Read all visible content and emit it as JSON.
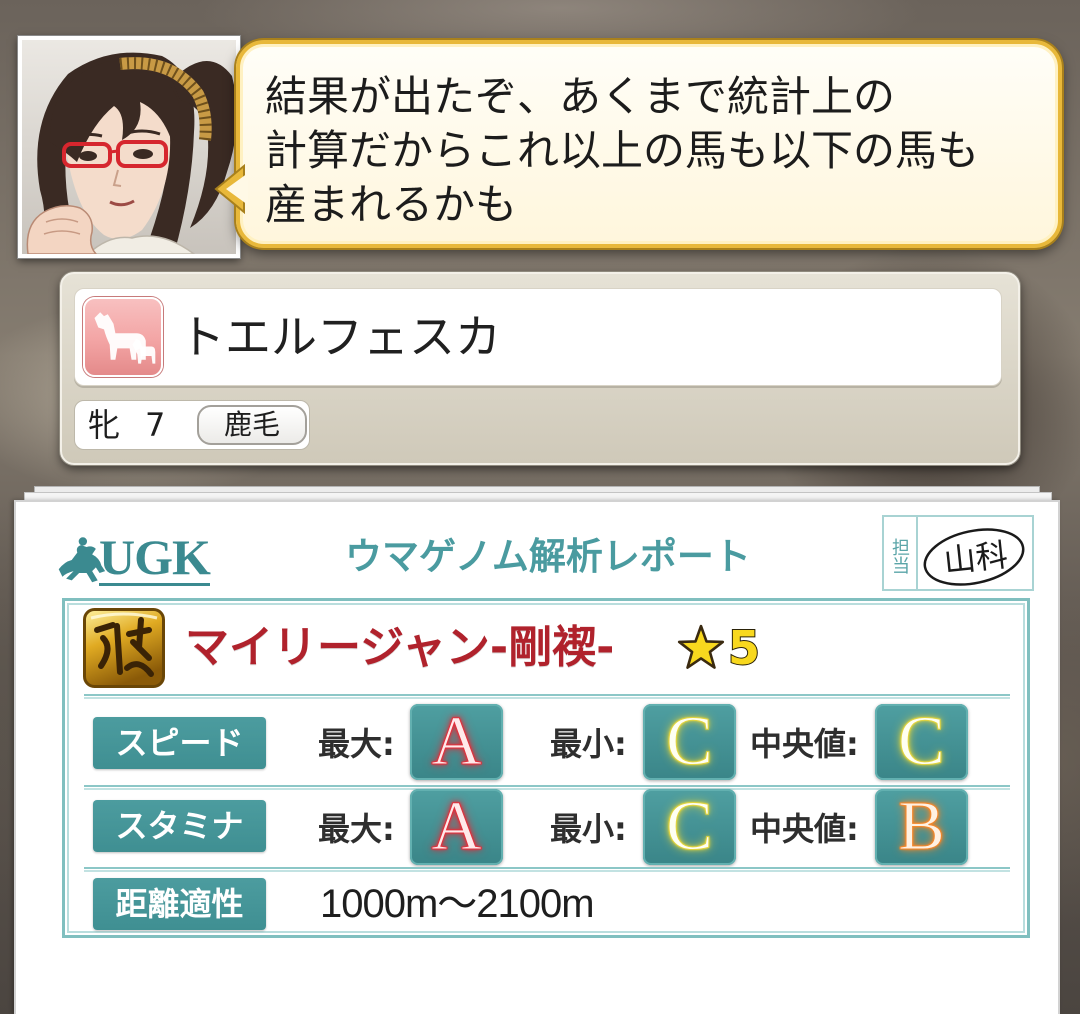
{
  "dialog": {
    "lines": [
      "結果が出たぞ、あくまで統計上の",
      "計算だからこれ以上の馬も以下の馬も",
      "産まれるかも"
    ]
  },
  "horse": {
    "icon": "mare-horse-icon",
    "name": "トエルフェスカ",
    "sex": "牝",
    "age": "7",
    "coat": "鹿毛"
  },
  "report": {
    "logo_icon": "ugk-horse-logo-icon",
    "logo_text": "UGK",
    "title": "ウマゲノム解析レポート",
    "stamp_label": "担当",
    "signature": "山科",
    "lineage": {
      "icon": "gold-lineage-icon",
      "name": "マイリージャン-剛褉-",
      "rank_icon": "star-icon",
      "rank": "5"
    },
    "rows": [
      {
        "label": "スピード",
        "stats": [
          {
            "label": "最大:",
            "grade": "A"
          },
          {
            "label": "最小:",
            "grade": "C"
          },
          {
            "label": "中央値:",
            "grade": "C"
          }
        ]
      },
      {
        "label": "スタミナ",
        "stats": [
          {
            "label": "最大:",
            "grade": "A"
          },
          {
            "label": "最小:",
            "grade": "C"
          },
          {
            "label": "中央値:",
            "grade": "B"
          }
        ]
      },
      {
        "label": "距離適性",
        "value": "1000m〜2100m"
      }
    ]
  },
  "icons": {
    "portrait": "character-portrait"
  },
  "colors": {
    "teal": "#3f8f92",
    "teal-light": "#8cc6c6",
    "teal-text": "#4a9ba0",
    "red": "#b0222c",
    "gold": "#e8b83a",
    "pink": "#f3a4a4",
    "star": "#f8d81e",
    "grade_styles": {
      "A": {
        "fill": "#ffe9ea",
        "glow": "#e0303c"
      },
      "B": {
        "fill": "#fff1e2",
        "glow": "#f4872a"
      },
      "C": {
        "fill": "#fffff2",
        "glow": "#e2d43e"
      }
    }
  }
}
